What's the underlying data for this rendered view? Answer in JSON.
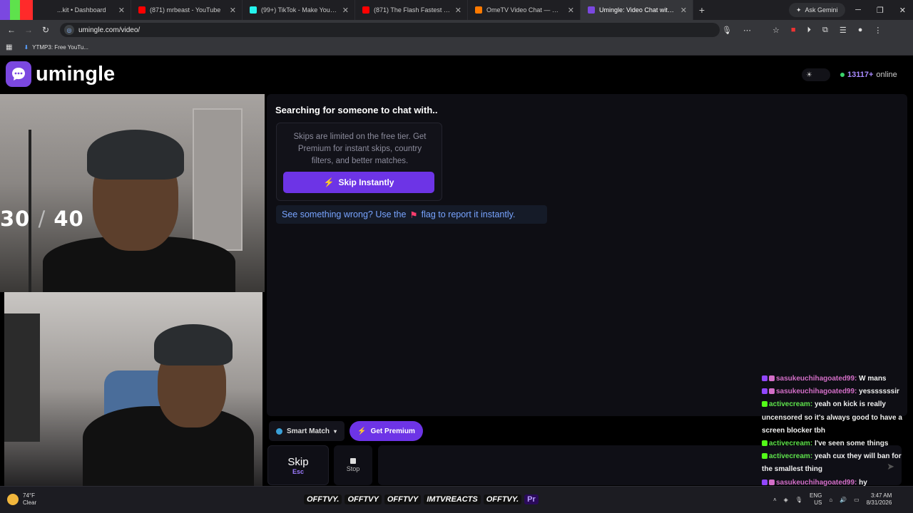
{
  "browser": {
    "tabs": [
      {
        "title": "...kit • Dashboard",
        "color": "#5ee24c"
      },
      {
        "title": "(871) mrbeast - YouTube",
        "color": "#ff0000"
      },
      {
        "title": "(99+) TikTok - Make Your Day",
        "color": "#25f4ee"
      },
      {
        "title": "(871) The Flash Fastest Moment",
        "color": "#ff0000"
      },
      {
        "title": "OmeTV Video Chat — Ome",
        "color": "#ff7a00"
      },
      {
        "title": "Umingle: Video Chat with S",
        "color": "#7b48e0",
        "active": true
      }
    ],
    "ask_gemini": "Ask Gemini",
    "url": "umingle.com/video/",
    "bookmark": "YTMP3: Free YouTu..."
  },
  "site": {
    "logo_text": "umingle",
    "online_count": "13117+",
    "online_label": "online"
  },
  "overlay_counter": {
    "current": "30",
    "separator": "/",
    "total": "40"
  },
  "chat": {
    "status": "Searching for someone to chat with..",
    "free_tier_text": "Skips are limited on the free tier. Get Premium for instant skips, country filters, and better matches.",
    "skip_instantly_label": "Skip Instantly",
    "report_prefix": "See something wrong? Use the",
    "report_suffix": "flag to report it instantly."
  },
  "controls": {
    "smart_match_label": "Smart Match",
    "get_premium_label": "Get Premium",
    "skip_label": "Skip",
    "skip_key": "Esc",
    "stop_label": "Stop"
  },
  "stream_chat": [
    {
      "user": "sasukeuchihagoated99:",
      "text": "W mans",
      "platform": "twitch"
    },
    {
      "user": "sasukeuchihagoated99:",
      "text": "yesssssssir",
      "platform": "twitch"
    },
    {
      "user": "activecream:",
      "text": "yeah on kick is really uncensored so it's always good to have a screen blocker tbh",
      "platform": "kick"
    },
    {
      "user": "activecream:",
      "text": "I've seen some things",
      "platform": "kick"
    },
    {
      "user": "activecream:",
      "text": "yeah cux they will ban for the smallest thing",
      "platform": "kick"
    },
    {
      "user": "sasukeuchihagoated99:",
      "text": "hy",
      "platform": "twitch"
    }
  ],
  "taskbar": {
    "weather_temp": "74°F",
    "weather_desc": "Clear",
    "banners": [
      "OFFTVY.",
      "OFFTVY",
      "OFFTVY",
      "IMTVREACTS",
      "OFFTVY."
    ],
    "lang": "ENG",
    "region": "US",
    "time": "3:47 AM",
    "date": "8/31/2026"
  },
  "colors": {
    "accent": "#6d34e6",
    "link": "#78a4ff",
    "online_dot": "#3ad36a"
  }
}
